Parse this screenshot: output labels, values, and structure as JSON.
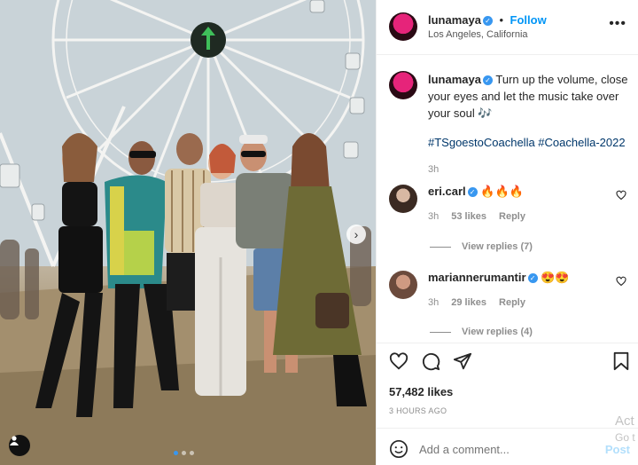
{
  "post": {
    "username": "lunamaya",
    "follow_label": "Follow",
    "location": "Los Angeles, California",
    "more_label": "•••",
    "caption": "Turn up the volume, close your eyes and let the music take over your soul 🎶",
    "hashtags": "#TSgoestoCoachella #Coachella-2022",
    "caption_time": "3h",
    "likes": "57,482 likes",
    "posted_ago": "3 HOURS AGO",
    "carousel": {
      "slides": 3,
      "active": 0
    }
  },
  "comments": [
    {
      "username": "eri.carl",
      "text": "🔥🔥🔥",
      "time": "3h",
      "likes": "53 likes",
      "reply_label": "Reply",
      "view_replies": "View replies (7)"
    },
    {
      "username": "mariannerumantir",
      "text": "😍😍",
      "time": "3h",
      "likes": "29 likes",
      "reply_label": "Reply",
      "view_replies": "View replies (4)"
    }
  ],
  "composer": {
    "placeholder": "Add a comment...",
    "post_label": "Post"
  },
  "watermark": {
    "line1": "Act",
    "line2": "Go t"
  },
  "colors": {
    "accent": "#0095f6",
    "verified": "#3897f0",
    "text": "#262626",
    "muted": "#8e8e8e"
  }
}
